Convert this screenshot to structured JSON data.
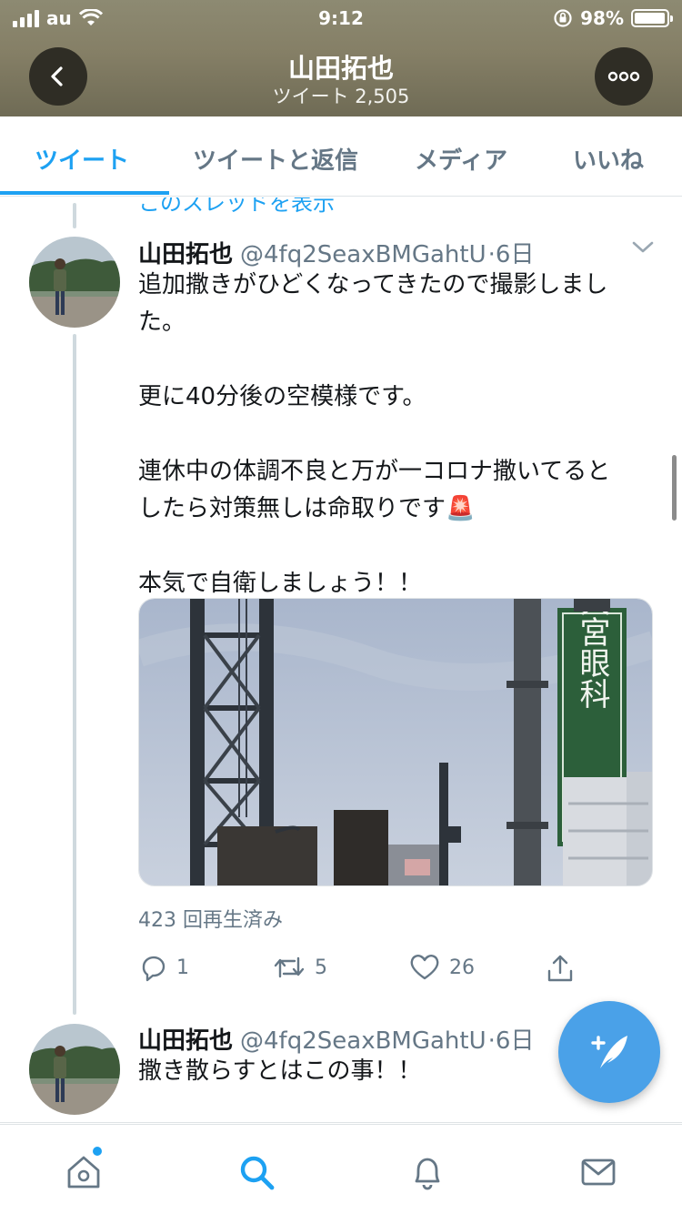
{
  "status_bar": {
    "carrier": "au",
    "time": "9:12",
    "battery": "98%"
  },
  "header": {
    "title": "山田拓也",
    "subtitle": "ツイート 2,505"
  },
  "tabs": [
    {
      "label": "ツイート",
      "active": true
    },
    {
      "label": "ツイートと返信",
      "active": false
    },
    {
      "label": "メディア",
      "active": false
    },
    {
      "label": "いいね",
      "active": false
    }
  ],
  "timeline": {
    "cut_text": "このスレッドを表示",
    "tweets": [
      {
        "name": "山田拓也",
        "handle": "@4fq2SeaxBMGahtU",
        "time": "·6日",
        "lines": [
          "追加撒きがひどくなってきたので撮影しまし",
          "た。",
          "",
          "更に40分後の空模様です。",
          "",
          "連休中の体調不良と万が一コロナ撒いてると",
          "したら対策無しは命取りです🚨",
          "",
          "本気で自衛しましょう！！"
        ],
        "media": {
          "sign_text": "新大宮眼科"
        },
        "views": "423 回再生済み",
        "actions": {
          "replies": "1",
          "retweets": "5",
          "likes": "26"
        }
      },
      {
        "name": "山田拓也",
        "handle": "@4fq2SeaxBMGahtU",
        "time": "·6日",
        "text": "撒き散らすとはこの事！！"
      }
    ]
  },
  "colors": {
    "accent": "#1da1f2",
    "secondary_text": "#657786",
    "fab": "#4aa1e8"
  }
}
